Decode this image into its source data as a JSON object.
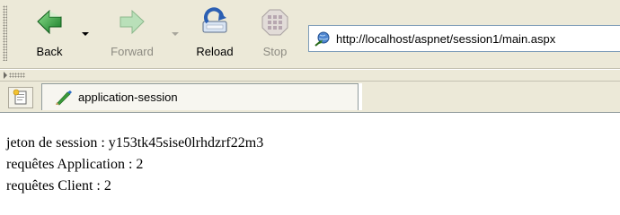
{
  "toolbar": {
    "back_label": "Back",
    "forward_label": "Forward",
    "reload_label": "Reload",
    "stop_label": "Stop"
  },
  "address": {
    "url": "http://localhost/aspnet/session1/main.aspx"
  },
  "tab": {
    "title": "application-session"
  },
  "page": {
    "line1": "jeton de session : y153tk45sise0lrhdzrf22m3",
    "line2": "requêtes Application : 2",
    "line3": "requêtes Client : 2"
  },
  "colors": {
    "chrome": "#ece9d8",
    "back_green": "#2e9a3a",
    "forward_green": "#9fcf9f",
    "reload_blue": "#2b5fb3",
    "border": "#919b9c"
  },
  "icons": [
    "back-icon",
    "forward-icon",
    "reload-icon",
    "stop-icon",
    "page-url-icon",
    "tab-favicon-icon",
    "new-tab-icon"
  ]
}
